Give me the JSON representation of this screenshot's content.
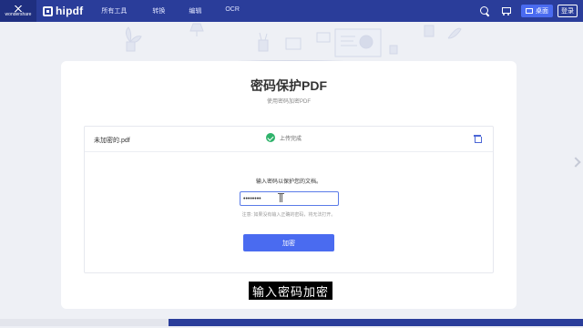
{
  "brand": {
    "company": "wondershare",
    "product": "hipdf"
  },
  "nav": {
    "items": [
      "所有工具",
      "转换",
      "编辑",
      "OCR"
    ]
  },
  "header_actions": {
    "desktop_label": "桌面",
    "login_label": "登录"
  },
  "page": {
    "title": "密码保护PDF",
    "subtitle": "使用密码加密PDF"
  },
  "file": {
    "name": "未加密的.pdf",
    "status": "上传完成"
  },
  "form": {
    "prompt": "输入密码以保护您的文档。",
    "password_value": "••••••••",
    "note": "注意: 如果没有输入正确的密码，将无法打开。",
    "submit_label": "加密"
  },
  "caption": "输入密码加密",
  "progress": {
    "fraction": 0.29
  },
  "colors": {
    "nav_bg": "#2a3d9a",
    "accent": "#4a6bf0",
    "success": "#2fb36b"
  }
}
